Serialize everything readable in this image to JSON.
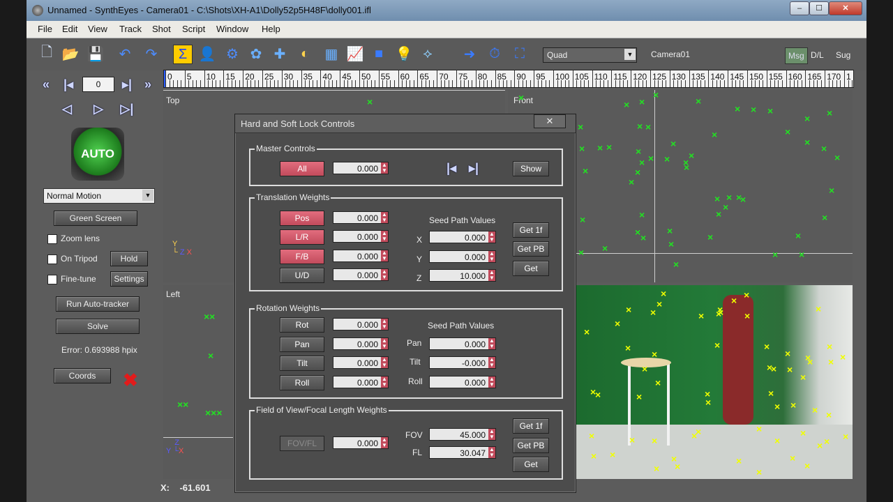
{
  "window": {
    "title": "Unnamed - SynthEyes - Camera01 - C:\\Shots\\XH-A1\\Dolly52p5H48F\\dolly001.ifl",
    "min": "–",
    "max": "☐",
    "close": "✕"
  },
  "menu": [
    "File",
    "Edit",
    "View",
    "Track",
    "Shot",
    "Script",
    "Window",
    "Help"
  ],
  "toolbar": {
    "icons": [
      {
        "name": "new-file-icon",
        "glyph": "🗋",
        "color": "#d8e6ff"
      },
      {
        "name": "open-folder-icon",
        "glyph": "📂",
        "color": "#9cc7ff"
      },
      {
        "name": "save-icon",
        "glyph": "💾",
        "color": "#9cc7ff"
      },
      {
        "name": "undo-icon",
        "glyph": "↶",
        "color": "#4d8cff"
      },
      {
        "name": "redo-icon",
        "glyph": "↷",
        "color": "#4d8cff"
      },
      {
        "name": "summary-sigma-icon",
        "glyph": "Σ",
        "color": "#1a3fff"
      },
      {
        "name": "camera-icon",
        "glyph": "👤",
        "color": "#4d8cff"
      },
      {
        "name": "solver-gear-icon",
        "glyph": "⚙",
        "color": "#4d8cff"
      },
      {
        "name": "paint-icon",
        "glyph": "✿",
        "color": "#6ab0ff"
      },
      {
        "name": "move-icon",
        "glyph": "✚",
        "color": "#6ab0ff"
      },
      {
        "name": "lens-icon",
        "glyph": "◐",
        "color": "#ffd24d"
      },
      {
        "name": "calculator-icon",
        "glyph": "▦",
        "color": "#6ab0ff"
      },
      {
        "name": "graph-icon",
        "glyph": "📈",
        "color": "#ffd24d"
      },
      {
        "name": "cube-icon",
        "glyph": "■",
        "color": "#3a7bff"
      },
      {
        "name": "lightbulb-icon",
        "glyph": "💡",
        "color": "#ffe94d"
      },
      {
        "name": "path-icon",
        "glyph": "⟡",
        "color": "#8fd0ff"
      },
      {
        "name": "arrow-right-icon",
        "glyph": "➜",
        "color": "#3a7bff"
      },
      {
        "name": "clock-icon",
        "glyph": "⏱",
        "color": "#3a7bff"
      },
      {
        "name": "fit-frame-icon",
        "glyph": "⛶",
        "color": "#3a7bff"
      }
    ],
    "layout_value": "Quad",
    "camera_label": "Camera01",
    "msg": "Msg",
    "dl": "D/L",
    "sug": "Sug"
  },
  "timeline": {
    "labels": [
      "0",
      "5",
      "10",
      "15",
      "20",
      "25",
      "30",
      "35",
      "40",
      "45",
      "50",
      "55",
      "60",
      "65",
      "70",
      "75",
      "80",
      "85",
      "90",
      "95",
      "100",
      "105",
      "110",
      "115",
      "120",
      "125",
      "130",
      "135",
      "140",
      "145",
      "150",
      "155",
      "160",
      "165",
      "170",
      "1"
    ]
  },
  "left": {
    "frame": "0",
    "auto_label": "AUTO",
    "motion_value": "Normal Motion",
    "green_screen": "Green Screen",
    "zoom_lens": "Zoom lens",
    "on_tripod": "On Tripod",
    "hold": "Hold",
    "fine_tune": "Fine-tune",
    "settings": "Settings",
    "run_autotracker": "Run Auto-tracker",
    "solve": "Solve",
    "error": "Error: 0.693988 hpix",
    "coords": "Coords"
  },
  "views": {
    "top": "Top",
    "front": "Front",
    "left": "Left"
  },
  "coord_readout": {
    "x_label": "X:",
    "x_value": "-61.601"
  },
  "dialog": {
    "title": "Hard and Soft Lock Controls",
    "close": "✕",
    "master": {
      "label": "Master Controls",
      "all": "All",
      "all_value": "0.000",
      "show": "Show"
    },
    "translation": {
      "label": "Translation Weights",
      "pos": "Pos",
      "pos_value": "0.000",
      "lr": "L/R",
      "lr_value": "0.000",
      "fb": "F/B",
      "fb_value": "0.000",
      "ud": "U/D",
      "ud_value": "0.000",
      "seed_title": "Seed Path Values",
      "x": "X",
      "x_value": "0.000",
      "y": "Y",
      "y_value": "0.000",
      "z": "Z",
      "z_value": "10.000",
      "get1f": "Get 1f",
      "getpb": "Get PB",
      "get": "Get"
    },
    "rotation": {
      "label": "Rotation Weights",
      "rot": "Rot",
      "rot_value": "0.000",
      "pan": "Pan",
      "pan_value": "0.000",
      "tilt": "Tilt",
      "tilt_value": "0.000",
      "roll": "Roll",
      "roll_value": "0.000",
      "seed_title": "Seed Path Values",
      "pan_l": "Pan",
      "pan_seed": "0.000",
      "tilt_l": "Tilt",
      "tilt_seed": "-0.000",
      "roll_l": "Roll",
      "roll_seed": "0.000"
    },
    "fov": {
      "label": "Field of View/Focal Length Weights",
      "fovfl": "FOV/FL",
      "fovfl_value": "0.000",
      "fov_l": "FOV",
      "fov_value": "45.000",
      "fl_l": "FL",
      "fl_value": "30.047",
      "get1f": "Get 1f",
      "getpb": "Get PB",
      "get": "Get"
    }
  }
}
